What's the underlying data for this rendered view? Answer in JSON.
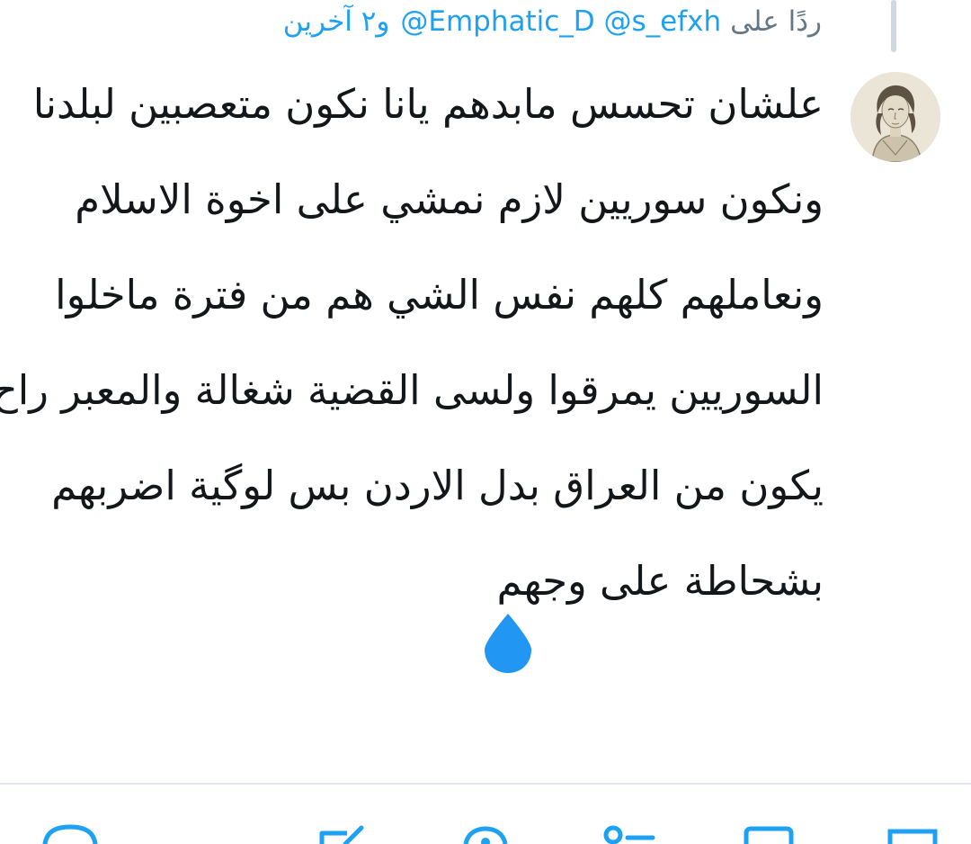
{
  "reply": {
    "prefix": "ردًا على",
    "mentions": "@Emphatic_D @s_efxh",
    "others": "و٢ آخرين"
  },
  "tweet": {
    "lines": [
      "علشان تحسس مابدهم يانا نكون متعصبين لبلدنا",
      "ونكون سوريين لازم نمشي على اخوة الاسلام",
      "ونعاملهم كلهم نفس الشي هم من فترة ماخلوا",
      "السوريين يمرقوا ولسى القضية شغالة والمعبر راح",
      "يكون من العراق بدل الاردن بس لوگية اضربهم",
      "بشحاطة على وجهم"
    ],
    "emoji": "droplet-icon"
  },
  "colors": {
    "accent": "#1da1f2",
    "text": "#14171a",
    "secondary": "#657786",
    "divider": "#e1e8ed"
  },
  "actions": [
    "reply-icon",
    "edit-icon",
    "search-icon",
    "retweet-icon",
    "like-icon",
    "share-icon"
  ]
}
